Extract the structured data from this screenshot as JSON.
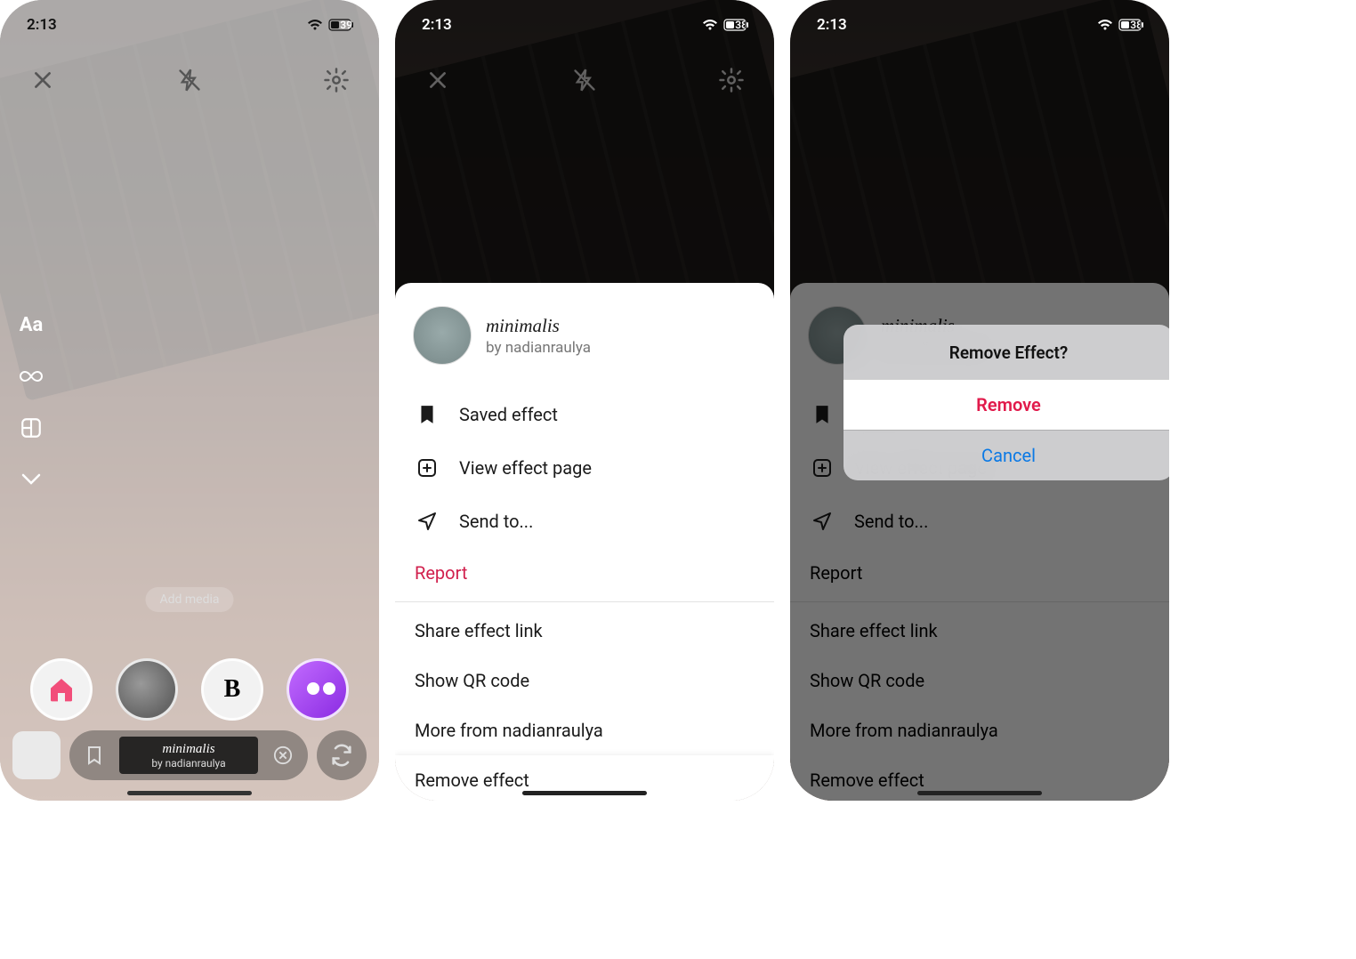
{
  "status": {
    "time": "2:13",
    "battery_1": "39",
    "battery_2": "38",
    "battery_3": "38"
  },
  "screen1": {
    "add_media": "Add media",
    "effect_name": "minimalis",
    "effect_by": "by nadianraulya"
  },
  "sheet": {
    "effect_name": "minimalis",
    "effect_by": "by nadianraulya",
    "items": {
      "saved": "Saved effect",
      "view_page": "View effect page",
      "send_to": "Send to...",
      "report": "Report",
      "share_link": "Share effect link",
      "show_qr": "Show QR code",
      "more_from": "More from nadianraulya",
      "remove": "Remove effect"
    }
  },
  "alert": {
    "title": "Remove Effect?",
    "remove": "Remove",
    "cancel": "Cancel"
  }
}
